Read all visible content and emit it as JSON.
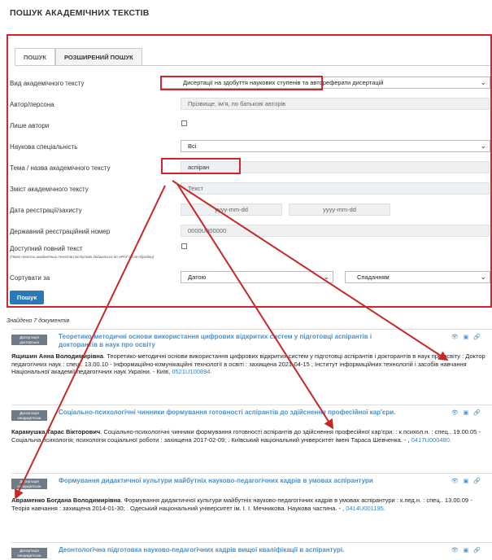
{
  "page_title": "ПОШУК АКАДЕМІЧНИХ ТЕКСТІВ",
  "tabs": [
    {
      "label": "ПОШУК"
    },
    {
      "label": "РОЗШИРЕНИЙ ПОШУК",
      "active": true
    }
  ],
  "form": {
    "type_label": "Вид академічного тексту",
    "type_value": "Дисертації на здобуття наукових ступенів та автореферати дисертацій",
    "author_label": "Автор/персона",
    "author_placeholder": "Прізвище, ім'я, по батькові авторів",
    "only_authors_label": "Лише автори",
    "specialty_label": "Наукова спеціальність",
    "specialty_value": "Всі",
    "topic_label": "Тема / назва академічного тексту",
    "topic_value": "аспіран",
    "content_label": "Зміст академічного тексту",
    "content_placeholder": "Текст",
    "date_label": "Дата реєстрації/захисту",
    "date_from_placeholder": "yyyy-mm-dd",
    "date_to_placeholder": "yyyy-mm-dd",
    "regnum_label": "Державний реєстраційний номер",
    "regnum_placeholder": "0000U000000",
    "fulltext_label": "Доступний повний текст",
    "fulltext_note": "(Повні тексти академічних текстів поступово додаються до НРАТ після обробки)",
    "sort_label": "Сортувати за",
    "sort_value": "Датою",
    "order_value": "Спаданням",
    "search_button": "Пошук"
  },
  "found_text": "Знайдено 7 документів",
  "results": [
    {
      "badge": "Дисертація докторська",
      "title": "Теоретико-методичні основи використання цифрових відкритих систем у підготовці аспірантів і докторантів в наук про освіту",
      "author": "Ящишин Анна Володимирівна",
      "desc": ". Теоретико-методичні основи використання цифрових відкритих систем у підготовці аспірантів і докторантів в наук про освіту : Доктор педагогічних наук : спец.. 13.00.10 - Інформаційно-комунікаційні технології в освіті : захищена 2021-04-15 ; Інститут інформаційних технологій і засобів навчання Національної академії педагогічних наук України. - Київ, ",
      "link": "0521U100894."
    },
    {
      "badge": "Дисертація кандидатська",
      "title": "Соціально-психологічні чинники формування готовності аспірантів до здійснення професійної кар'єри.",
      "author": "Карамушка Тарас Вікторович",
      "desc": ". Соціально-психологічні чинники формування готовності аспірантів до здійснення професійної кар'єри. : к.психол.н. : спец.. 19.00.05 - Соціальна психологія; психологія соціальної роботи : захищена 2017-02-09; . Київський національний університет імені Тараса Шевченка. - , ",
      "link": "0417U000480."
    },
    {
      "badge": "Дисертація кандидатська",
      "title": "Формування дидактичної культури майбутніх науково-педагогічних кадрів в умовах аспірантури",
      "author": "Авраменко Богдана Володимирівна",
      "desc": ". Формування дидактичної культури майбутніх науково-педагогічних кадрів в умовах аспірантури : к.пед.н. : спец.. 13.00.09 - Теорія навчання : захищена 2014-01-30; . Одеський національний університет ім. І. І. Мечникова. Наукова частина. - , ",
      "link": "0414U001195."
    },
    {
      "badge": "Дисертація кандидатська",
      "title": "Деонтологічна підготовка науково-педагогічних кадрів вищої кваліфікації в аспірантурі.",
      "author": "",
      "desc": "",
      "link": ""
    }
  ],
  "colors": {
    "accent": "#2a7ab8",
    "link": "#4a90c9",
    "highlight": "#d8232a",
    "badge": "#6f7c88"
  },
  "icons": [
    "eye-icon",
    "card-icon",
    "link-icon"
  ]
}
